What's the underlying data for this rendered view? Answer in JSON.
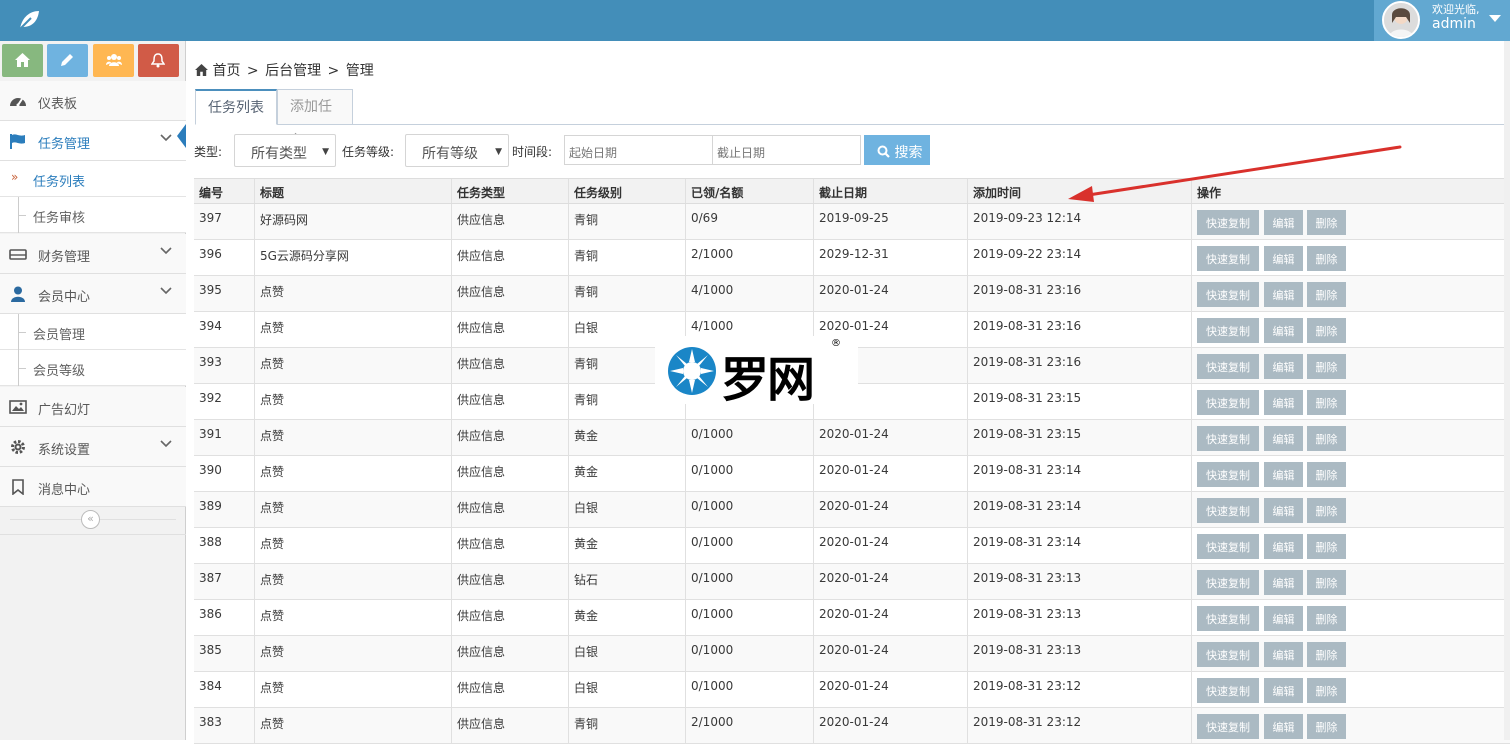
{
  "header": {
    "logo_icon": "leaf-icon",
    "welcome": "欢迎光临,",
    "username": "admin"
  },
  "shortcuts": [
    {
      "icon": "home-icon",
      "color": "#87b87f"
    },
    {
      "icon": "pencil-icon",
      "color": "#6fb3e0"
    },
    {
      "icon": "users-icon",
      "color": "#ffb752"
    },
    {
      "icon": "bell-icon",
      "color": "#d15b47"
    }
  ],
  "sidebar": {
    "dashboard": "仪表板",
    "task_mgmt": "任务管理",
    "task_list": "任务列表",
    "task_review": "任务审核",
    "finance": "财务管理",
    "member_center": "会员中心",
    "member_mgmt": "会员管理",
    "member_level": "会员等级",
    "ads": "广告幻灯",
    "settings": "系统设置",
    "messages": "消息中心",
    "collapse": "«"
  },
  "breadcrumb": {
    "home": "首页",
    "sep1": ">",
    "backend": "后台管理",
    "sep2": ">",
    "current": "管理"
  },
  "tabs": {
    "list": "任务列表",
    "add": "添加任务"
  },
  "filters": {
    "type_label": "类型:",
    "type_value": "所有类型",
    "level_label": "任务等级:",
    "level_value": "所有等级",
    "period_label": "时间段:",
    "start_placeholder": "起始日期",
    "end_placeholder": "截止日期",
    "search_label": "搜索"
  },
  "table": {
    "headers": [
      "编号",
      "标题",
      "任务类型",
      "任务级别",
      "已领/名额",
      "截止日期",
      "添加时间",
      "操作"
    ],
    "actions": {
      "copy": "快速复制",
      "edit": "编辑",
      "delete": "删除"
    },
    "rows": [
      [
        "397",
        "好源码网",
        "供应信息",
        "青铜",
        "0/69",
        "2019-09-25",
        "2019-09-23 12:14"
      ],
      [
        "396",
        "5G云源码分享网",
        "供应信息",
        "青铜",
        "2/1000",
        "2029-12-31",
        "2019-09-22 23:14"
      ],
      [
        "395",
        "点赞",
        "供应信息",
        "青铜",
        "4/1000",
        "2020-01-24",
        "2019-08-31 23:16"
      ],
      [
        "394",
        "点赞",
        "供应信息",
        "白银",
        "4/1000",
        "2020-01-24",
        "2019-08-31 23:16"
      ],
      [
        "393",
        "点赞",
        "供应信息",
        "青铜",
        "",
        "01-24",
        "2019-08-31 23:16"
      ],
      [
        "392",
        "点赞",
        "供应信息",
        "青铜",
        "",
        "01-24",
        "2019-08-31 23:15"
      ],
      [
        "391",
        "点赞",
        "供应信息",
        "黄金",
        "0/1000",
        "2020-01-24",
        "2019-08-31 23:15"
      ],
      [
        "390",
        "点赞",
        "供应信息",
        "黄金",
        "0/1000",
        "2020-01-24",
        "2019-08-31 23:14"
      ],
      [
        "389",
        "点赞",
        "供应信息",
        "白银",
        "0/1000",
        "2020-01-24",
        "2019-08-31 23:14"
      ],
      [
        "388",
        "点赞",
        "供应信息",
        "黄金",
        "0/1000",
        "2020-01-24",
        "2019-08-31 23:14"
      ],
      [
        "387",
        "点赞",
        "供应信息",
        "钻石",
        "0/1000",
        "2020-01-24",
        "2019-08-31 23:13"
      ],
      [
        "386",
        "点赞",
        "供应信息",
        "黄金",
        "0/1000",
        "2020-01-24",
        "2019-08-31 23:13"
      ],
      [
        "385",
        "点赞",
        "供应信息",
        "白银",
        "0/1000",
        "2020-01-24",
        "2019-08-31 23:13"
      ],
      [
        "384",
        "点赞",
        "供应信息",
        "白银",
        "0/1000",
        "2020-01-24",
        "2019-08-31 23:12"
      ],
      [
        "383",
        "点赞",
        "供应信息",
        "青铜",
        "2/1000",
        "2020-01-24",
        "2019-08-31 23:12"
      ]
    ]
  },
  "watermark": {
    "text": "罗网",
    "reg": "®"
  },
  "colors": {
    "header_bg": "#438eb9",
    "accent": "#2b7dbc",
    "search_btn": "#6fb3e0",
    "action_btn": "#abbac3",
    "arrow": "#d9312c"
  }
}
